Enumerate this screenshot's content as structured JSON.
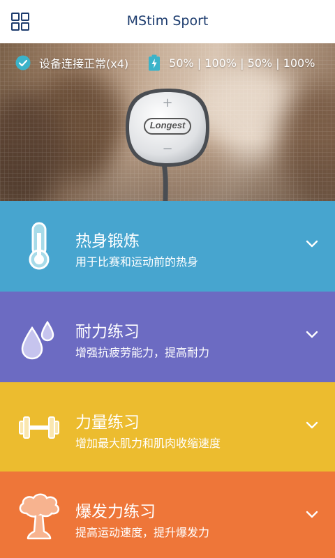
{
  "header": {
    "title": "MStim Sport",
    "menu_icon": "grid-icon"
  },
  "status": {
    "connection_text": "设备连接正常(x4)",
    "battery_text": "50% | 100% | 50% | 100%",
    "check_icon": "check-circle-icon",
    "battery_icon": "battery-bolt-icon",
    "check_color": "#3bb3c9"
  },
  "device": {
    "brand": "Longest",
    "plus": "+",
    "minus": "−"
  },
  "cards": [
    {
      "title": "热身锻炼",
      "subtitle": "用于比赛和运动前的热身",
      "icon": "thermometer-icon",
      "color": "#47a5cf"
    },
    {
      "title": "耐力练习",
      "subtitle": "增强抗疲劳能力，提高耐力",
      "icon": "water-drops-icon",
      "color": "#6c6bc2"
    },
    {
      "title": "力量练习",
      "subtitle": "增加最大肌力和肌肉收缩速度",
      "icon": "dumbbell-icon",
      "color": "#ecbc2f"
    },
    {
      "title": "爆发力练习",
      "subtitle": "提高运动速度，提升爆发力",
      "icon": "mushroom-cloud-icon",
      "color": "#ee7639"
    }
  ]
}
